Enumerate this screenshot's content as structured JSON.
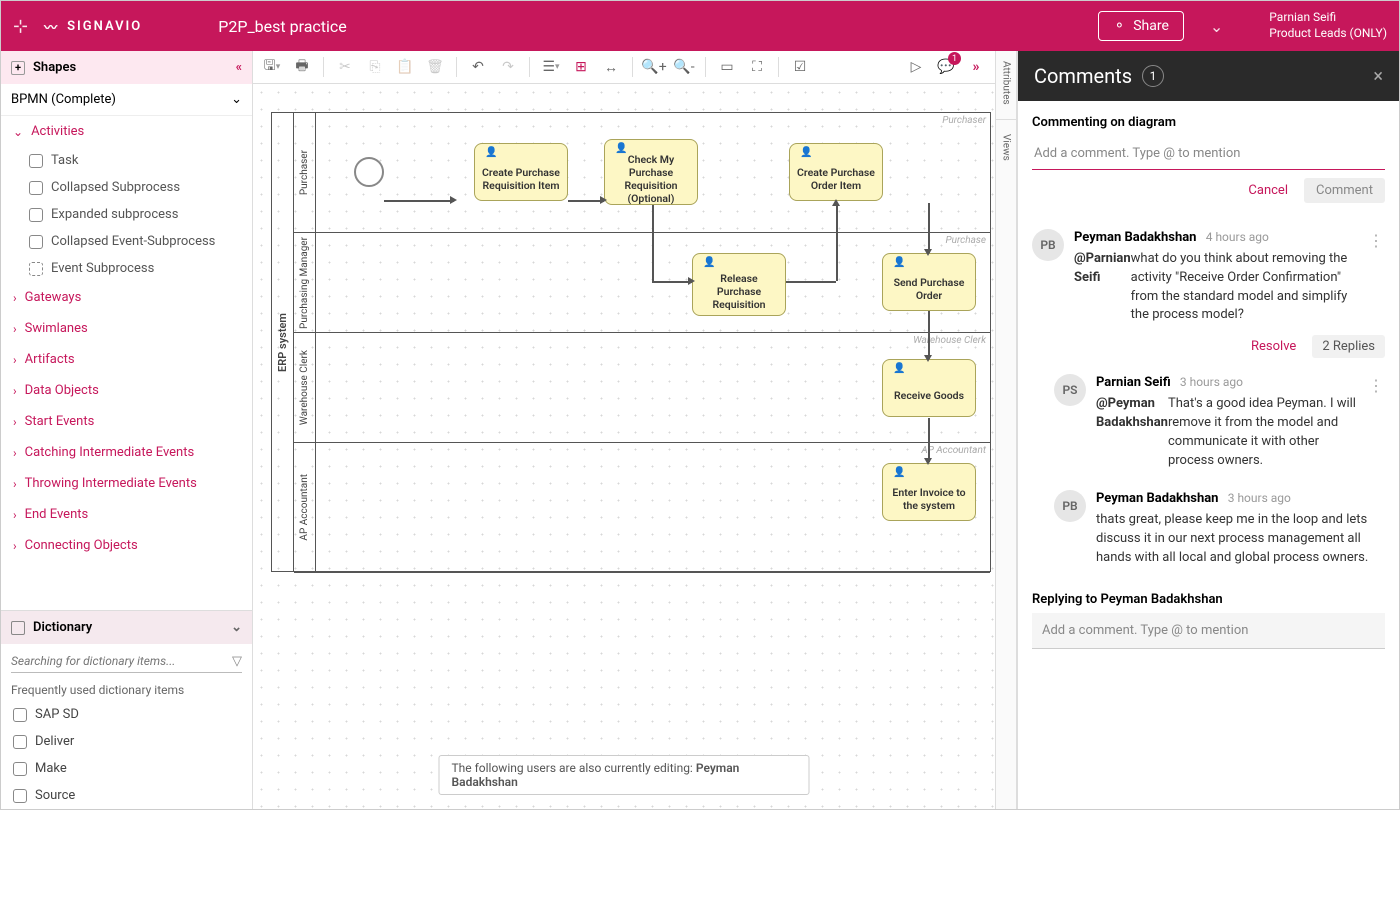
{
  "header": {
    "brand": "SIGNAVIO",
    "title": "P2P_best practice",
    "share": "Share",
    "user_name": "Parnian Seifi",
    "user_role": "Product Leads (ONLY)"
  },
  "sidebar": {
    "shapes_header": "Shapes",
    "profile": "BPMN (Complete)",
    "activities_label": "Activities",
    "items": [
      {
        "label": "Task"
      },
      {
        "label": "Collapsed Subprocess"
      },
      {
        "label": "Expanded subprocess"
      },
      {
        "label": "Collapsed Event-Subprocess"
      },
      {
        "label": "Event Subprocess"
      }
    ],
    "categories": [
      "Gateways",
      "Swimlanes",
      "Artifacts",
      "Data Objects",
      "Start Events",
      "Catching Intermediate Events",
      "Throwing Intermediate Events",
      "End Events",
      "Connecting Objects"
    ],
    "dictionary_label": "Dictionary",
    "dictionary_search_placeholder": "Searching for dictionary items...",
    "dictionary_freq": "Frequently used dictionary items",
    "dictionary_items": [
      "SAP SD",
      "Deliver",
      "Make",
      "Source"
    ]
  },
  "canvas": {
    "pool": "ERP system",
    "lanes": [
      "Purchaser",
      "Purchasing Manager",
      "Warehouse Clerk",
      "AP Accountant"
    ],
    "lane_labels": [
      "Purchaser",
      "Purchase",
      "Warehouse Clerk",
      "AP Accountant"
    ],
    "tasks": {
      "t1": "Create Purchase Requisition Item",
      "t2": "Check My Purchase Requisition (Optional)",
      "t3": "Create Purchase Order Item",
      "t4": "Release Purchase Requisition",
      "t5": "Send Purchase Order",
      "t6": "Receive Goods",
      "t7": "Enter Invoice to the system"
    },
    "collab_prefix": "The following users are also currently editing: ",
    "collab_user": "Peyman Badakhshan"
  },
  "ribbon": {
    "tab1": "Attributes",
    "tab2": "Views"
  },
  "comments": {
    "title": "Comments",
    "count": "1",
    "on": "Commenting on diagram",
    "placeholder": "Add a comment. Type @ to mention",
    "cancel": "Cancel",
    "comment": "Comment",
    "resolve": "Resolve",
    "replies": "2 Replies",
    "thread": {
      "a": {
        "av": "PB",
        "name": "Peyman Badakhshan",
        "time": "4 hours ago",
        "mention": "@Parnian Seifi",
        "body": " what do you think about removing the activity \"Receive Order Confirmation\" from the standard model and simplify the process model?"
      },
      "r1": {
        "av": "PS",
        "name": "Parnian Seifi",
        "time": "3 hours ago",
        "mention": "@Peyman Badakhshan",
        "body": " That's a good idea Peyman. I will remove it from the model and communicate it with other process owners."
      },
      "r2": {
        "av": "PB",
        "name": "Peyman Badakhshan",
        "time": "3 hours ago",
        "body": "thats great, please keep me in the loop and lets discuss it in our next process management all hands with all local and global process owners."
      }
    },
    "replying_to": "Replying to Peyman Badakhshan",
    "reply_placeholder": "Add a comment. Type @ to mention"
  }
}
